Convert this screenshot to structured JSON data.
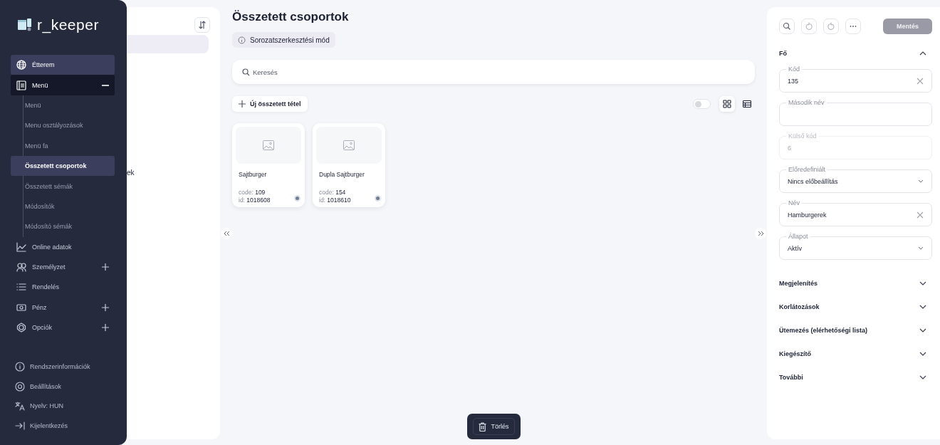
{
  "sidebar": {
    "logo": "r_keeper",
    "items": [
      {
        "label": "Étterem",
        "selected": true
      },
      {
        "label": "Menü",
        "selected": false,
        "expanded": true,
        "children": [
          {
            "label": "Menü",
            "selected": false
          },
          {
            "label": "Menu osztályozások",
            "selected": false
          },
          {
            "label": "Menü fa",
            "selected": false
          },
          {
            "label": "Összetett csoportok",
            "selected": true
          },
          {
            "label": "Összetett sémák",
            "selected": false
          },
          {
            "label": "Módosítók",
            "selected": false
          },
          {
            "label": "Módosító sémák",
            "selected": false
          }
        ]
      },
      {
        "label": "Online adatok",
        "selected": false
      },
      {
        "label": "Személyzet",
        "selected": false,
        "expanded": false
      },
      {
        "label": "Rendelés",
        "selected": false
      },
      {
        "label": "Pénz",
        "selected": false,
        "expanded": false
      },
      {
        "label": "Opciók",
        "selected": false,
        "expanded": false
      }
    ],
    "footer": [
      {
        "label": "Rendszerinformációk"
      },
      {
        "label": "Beállítások"
      },
      {
        "label": "Nyelv: HUN"
      },
      {
        "label": "Kijelentkezés"
      }
    ]
  },
  "tree": {
    "rows": [
      {
        "selected": true
      },
      {
        "label": "ek",
        "selected": false
      }
    ]
  },
  "main": {
    "title": "Összetett csoportok",
    "mode_badge": "Sorozatszerkesztési mód",
    "search": {
      "placeholder": "Keresés"
    },
    "new_button": "Új összetett tétel",
    "toggle": {
      "on": false
    },
    "views": [
      {
        "kind": "grid",
        "selected": true
      },
      {
        "kind": "list",
        "selected": false
      }
    ],
    "cards": [
      {
        "name": "Sajtburger",
        "lines": [
          {
            "label": "code:",
            "value": "109"
          },
          {
            "label": "id:",
            "value": "1018608"
          }
        ]
      },
      {
        "name": "Dupla Sajtburger",
        "lines": [
          {
            "label": "code:",
            "value": "154"
          },
          {
            "label": "id:",
            "value": "1018610"
          }
        ]
      }
    ],
    "delete_button": "Törlés"
  },
  "details": {
    "save_button": {
      "label": "Mentés",
      "disabled": true
    },
    "sections": [
      {
        "title": "Fő",
        "expanded": true,
        "fields": [
          {
            "kind": "text",
            "label": "Kód",
            "value": "135",
            "disabled": false,
            "clearable": true
          },
          {
            "kind": "text",
            "label": "Második név",
            "disabled": false,
            "clearable": false
          },
          {
            "kind": "text",
            "label": "Külső kód",
            "value": "6",
            "disabled": true,
            "clearable": false
          },
          {
            "kind": "select",
            "label": "Előredefiniált",
            "value": "Nincs előbeállítás",
            "disabled": false
          },
          {
            "kind": "text",
            "label": "Név",
            "value": "Hamburgerek",
            "disabled": false,
            "clearable": true
          },
          {
            "kind": "select",
            "label": "Állapot",
            "value": "Aktív",
            "disabled": false
          }
        ]
      },
      {
        "title": "Megjelenítés",
        "expanded": false
      },
      {
        "title": "Korlátozások",
        "expanded": false
      },
      {
        "title": "Ütemezés (elérhetőségi lista)",
        "expanded": false
      },
      {
        "title": "Kiegészítő",
        "expanded": false
      },
      {
        "title": "További",
        "expanded": false
      }
    ]
  }
}
